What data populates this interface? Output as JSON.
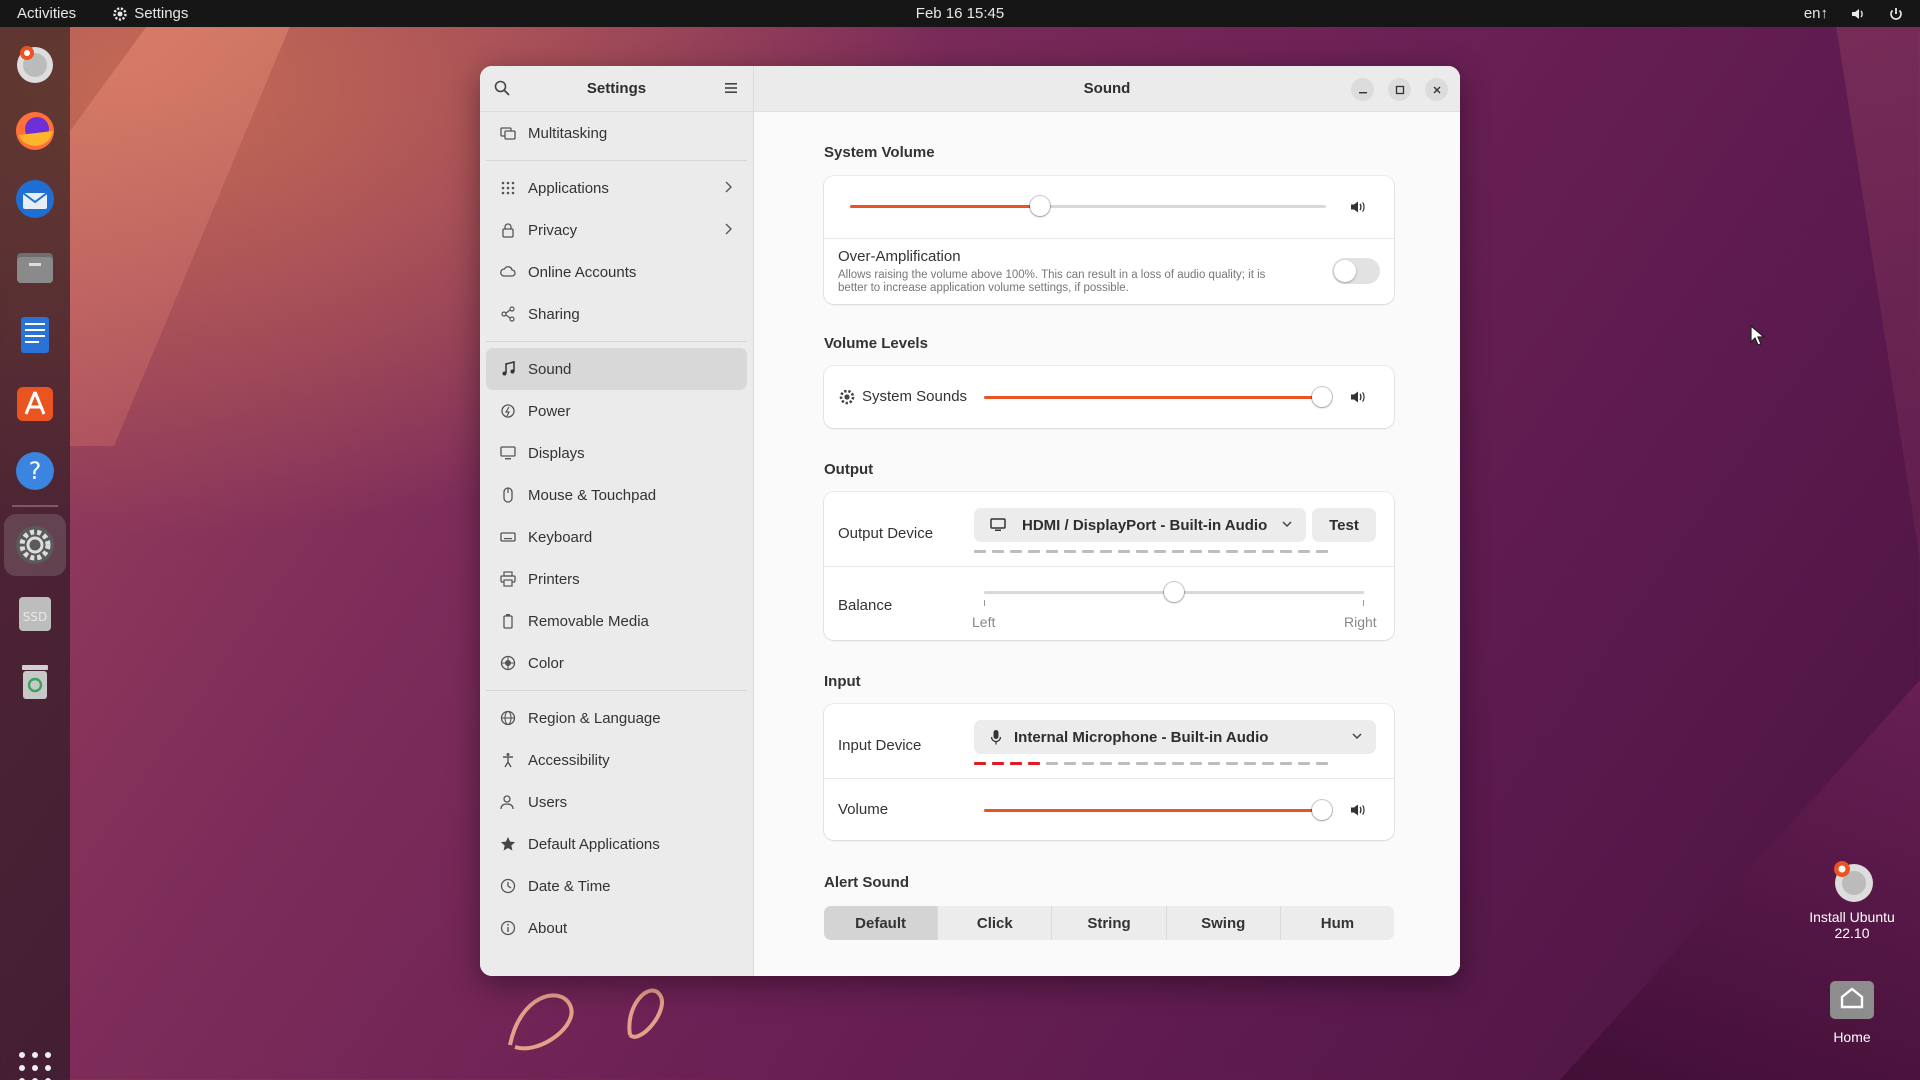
{
  "topbar": {
    "activities": "Activities",
    "app_name": "Settings",
    "clock": "Feb 16  15:45",
    "keyboard_layout": "en↑"
  },
  "desktop": {
    "install_label": "Install Ubuntu 22.10",
    "home_label": "Home"
  },
  "dock": {
    "items": [
      "installer-icon",
      "firefox-icon",
      "thunderbird-icon",
      "files-icon",
      "writer-icon",
      "app-center-icon",
      "help-icon",
      "settings-icon",
      "ssd-icon",
      "trash-icon"
    ],
    "ssd_label": "SSD"
  },
  "sidebar": {
    "title": "Settings",
    "items": [
      {
        "label": "Multitasking",
        "icon": "multitasking-icon"
      },
      {
        "label": "Applications",
        "icon": "applications-icon",
        "chevron": true
      },
      {
        "label": "Privacy",
        "icon": "privacy-icon",
        "chevron": true
      },
      {
        "label": "Online Accounts",
        "icon": "cloud-icon"
      },
      {
        "label": "Sharing",
        "icon": "share-icon"
      },
      {
        "label": "Sound",
        "icon": "music-note-icon",
        "active": true
      },
      {
        "label": "Power",
        "icon": "power-icon"
      },
      {
        "label": "Displays",
        "icon": "display-icon"
      },
      {
        "label": "Mouse & Touchpad",
        "icon": "mouse-icon"
      },
      {
        "label": "Keyboard",
        "icon": "keyboard-icon"
      },
      {
        "label": "Printers",
        "icon": "printer-icon"
      },
      {
        "label": "Removable Media",
        "icon": "removable-media-icon"
      },
      {
        "label": "Color",
        "icon": "color-icon"
      },
      {
        "label": "Region & Language",
        "icon": "globe-icon"
      },
      {
        "label": "Accessibility",
        "icon": "accessibility-icon"
      },
      {
        "label": "Users",
        "icon": "users-icon"
      },
      {
        "label": "Default Applications",
        "icon": "star-icon"
      },
      {
        "label": "Date & Time",
        "icon": "clock-icon"
      },
      {
        "label": "About",
        "icon": "info-icon"
      }
    ]
  },
  "main": {
    "title": "Sound",
    "system_volume": {
      "title": "System Volume",
      "level": 0.4,
      "over_amp_label": "Over-Amplification",
      "over_amp_desc_1": "Allows raising the volume above 100%. This can result in a loss of audio quality; it is",
      "over_amp_desc_2": "better to increase application volume settings, if possible.",
      "over_amp_on": false
    },
    "volume_levels": {
      "title": "Volume Levels",
      "system_sounds_label": "System Sounds",
      "system_sounds_level": 1.0
    },
    "output": {
      "title": "Output",
      "device_label": "Output Device",
      "device_value": "HDMI / DisplayPort - Built-in Audio",
      "test_label": "Test",
      "balance_label": "Balance",
      "balance_value": 0.5,
      "left_label": "Left",
      "right_label": "Right",
      "level_segments": 20,
      "level_on": 0
    },
    "input": {
      "title": "Input",
      "device_label": "Input Device",
      "device_value": "Internal Microphone - Built-in Audio",
      "volume_label": "Volume",
      "volume_level": 1.0,
      "level_segments": 20,
      "level_on": 4
    },
    "alert_sound": {
      "title": "Alert Sound",
      "options": [
        "Default",
        "Click",
        "String",
        "Swing",
        "Hum"
      ],
      "selected": 0
    }
  },
  "colors": {
    "accent": "#e95420",
    "level_on": "#e01b24"
  }
}
